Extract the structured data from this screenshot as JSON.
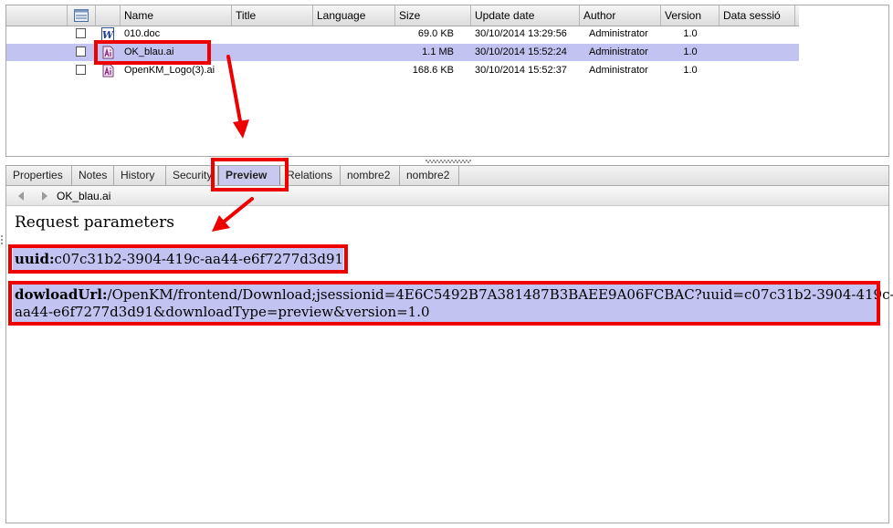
{
  "table": {
    "columns": [
      "Name",
      "Title",
      "Language",
      "Size",
      "Update date",
      "Author",
      "Version",
      "Data sessió"
    ],
    "rows": [
      {
        "name": "010.doc",
        "title": "",
        "language": "",
        "size": "69.0 KB",
        "update_date": "30/10/2014 13:29:56",
        "author": "Administrator",
        "version": "1.0",
        "icon": "word-doc-icon",
        "selected": false
      },
      {
        "name": "OK_blau.ai",
        "title": "",
        "language": "",
        "size": "1.1 MB",
        "update_date": "30/10/2014 15:52:24",
        "author": "Administrator",
        "version": "1.0",
        "icon": "illustrator-file-icon",
        "selected": true
      },
      {
        "name": "OpenKM_Logo(3).ai",
        "title": "",
        "language": "",
        "size": "168.6 KB",
        "update_date": "30/10/2014 15:52:37",
        "author": "Administrator",
        "version": "1.0",
        "icon": "illustrator-file-icon",
        "selected": false
      }
    ]
  },
  "tabs": [
    "Properties",
    "Notes",
    "History",
    "Security",
    "Preview",
    "Relations",
    "nombre2",
    "nombre2"
  ],
  "active_tab": "Preview",
  "toolbar": {
    "filename": "OK_blau.ai"
  },
  "preview": {
    "heading": "Request parameters",
    "uuid_label": "uuid:",
    "uuid_value": "c07c31b2-3904-419c-aa44-e6f7277d3d91",
    "download_label": "dowloadUrl:",
    "download_line1": "/OpenKM/frontend/Download;jsessionid=4E6C5492B7A381487B3BAEE9A06FCBAC?uuid=c07c31b2-3904-419c-",
    "download_line2": "aa44-e6f7277d3d91&downloadType=preview&version=1.0"
  },
  "colors": {
    "selection": "#c3c3f2",
    "annotation": "#ee0000",
    "active_tab": "#c9c9ef"
  }
}
